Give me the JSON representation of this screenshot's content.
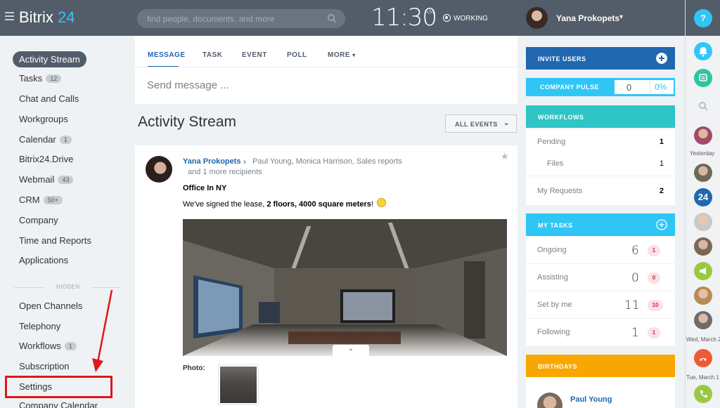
{
  "app": {
    "logo_name": "Bitrix",
    "logo_num": "24",
    "search_placeholder": "find people, documents, and more",
    "clock_time": "11:30",
    "clock_ampm": "AM",
    "status": "WORKING",
    "user_name": "Yana Prokopets"
  },
  "leftnav": {
    "items": [
      {
        "label": "Activity Stream"
      },
      {
        "label": "Tasks",
        "badge": "12"
      },
      {
        "label": "Chat and Calls"
      },
      {
        "label": "Workgroups"
      },
      {
        "label": "Calendar",
        "badge": "1"
      },
      {
        "label": "Bitrix24.Drive"
      },
      {
        "label": "Webmail",
        "badge": "43"
      },
      {
        "label": "CRM",
        "badge": "50+"
      },
      {
        "label": "Company"
      },
      {
        "label": "Time and Reports"
      },
      {
        "label": "Applications"
      }
    ],
    "hidden_label": "HIDDEN",
    "hidden_items": [
      {
        "label": "Open Channels"
      },
      {
        "label": "Telephony"
      },
      {
        "label": "Workflows",
        "badge": "1"
      },
      {
        "label": "Subscription"
      },
      {
        "label": "Settings"
      },
      {
        "label": "Company Calendar"
      }
    ]
  },
  "composer": {
    "tabs": [
      "MESSAGE",
      "TASK",
      "EVENT",
      "POLL",
      "MORE"
    ],
    "placeholder": "Send message ..."
  },
  "stream": {
    "title": "Activity Stream",
    "filter": "ALL EVENTS"
  },
  "post": {
    "author": "Yana Prokopets",
    "recipients": "Paul Young, Monica Harrison, Sales reports",
    "more_recipients": "and 1 more recipients",
    "title": "Office In NY",
    "text_before": "We've signed the lease, ",
    "text_bold": "2 floors, 4000 square meters",
    "text_after": "!",
    "photo_label": "Photo:"
  },
  "widgets": {
    "invite": "INVITE USERS",
    "pulse": {
      "label": "COMPANY PULSE",
      "value": "0",
      "percent": "0%"
    },
    "workflows": {
      "title": "WORKFLOWS",
      "rows": [
        {
          "label": "Pending",
          "value": "1"
        },
        {
          "label": "Files",
          "value": "1"
        },
        {
          "label": "My Requests",
          "value": "2"
        }
      ]
    },
    "tasks": {
      "title": "MY TASKS",
      "rows": [
        {
          "label": "Ongoing",
          "value": "6",
          "count": "1"
        },
        {
          "label": "Assisting",
          "value": "0",
          "count": "0"
        },
        {
          "label": "Set by me",
          "value": "11",
          "count": "10"
        },
        {
          "label": "Following",
          "value": "1",
          "count": "1"
        }
      ]
    },
    "birthdays": {
      "title": "BIRTHDAYS",
      "person": "Paul Young"
    }
  },
  "rail": {
    "help": "?",
    "yesterday": "Yesterday",
    "badge24": "24",
    "date1": "Wed, March 2",
    "date2": "Tue, March 1"
  },
  "colors": {
    "topbar": "#535c69",
    "accent_blue": "#2067b0",
    "sky": "#2fc6f6",
    "teal": "#2ec5c4",
    "amber": "#f7a700",
    "highlight_red": "#e01818"
  }
}
